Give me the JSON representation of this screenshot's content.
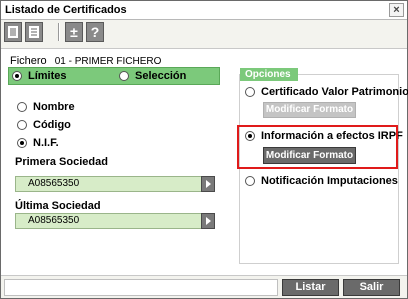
{
  "window": {
    "title": "Listado de Certificados",
    "close_glyph": "×"
  },
  "toolbar": {
    "buttons": [
      {
        "icon": "print-icon"
      },
      {
        "icon": "list-icon"
      },
      {
        "icon": "plus-minus-icon",
        "glyph": "±"
      },
      {
        "icon": "help-icon",
        "glyph": "?"
      }
    ]
  },
  "fichero": {
    "label": "Fichero",
    "value": "01 - PRIMER FICHERO"
  },
  "range": {
    "limites_label": "Límites",
    "seleccion_label": "Selección",
    "selected": "limites"
  },
  "sort": {
    "options": [
      "Nombre",
      "Código",
      "N.I.F."
    ],
    "selected": "N.I.F."
  },
  "primera_sociedad": {
    "label": "Primera Sociedad",
    "value": "A08565350"
  },
  "ultima_sociedad": {
    "label": "Última Sociedad",
    "value": "A08565350"
  },
  "opciones": {
    "title": "Opciones",
    "items": [
      {
        "label": "Certificado Valor Patrimonio",
        "button": "Modificar Formato"
      },
      {
        "label": "Información a efectos IRPF",
        "button": "Modificar Formato"
      },
      {
        "label": "Notificación Imputaciones"
      }
    ],
    "selected": "Información a efectos IRPF"
  },
  "footer": {
    "listar_label": "Listar",
    "salir_label": "Salir",
    "status_text": ""
  },
  "colors": {
    "accent_green": "#7cc97b",
    "field_green": "#d7ecc8",
    "highlight_red": "#e01a1a"
  }
}
